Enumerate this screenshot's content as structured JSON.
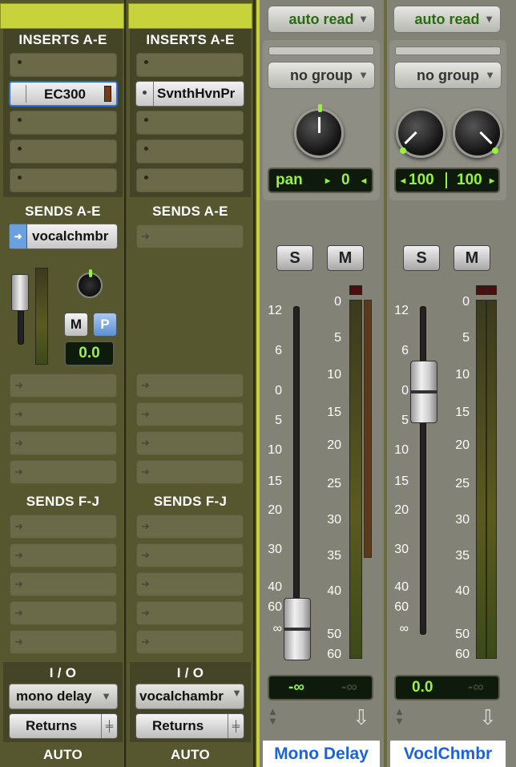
{
  "strip1": {
    "inserts_header": "INSERTS A-E",
    "insert_plugin": "EC300",
    "sends_ae_header": "SENDS A-E",
    "send_a": "vocalchmbr",
    "send_level": "0.0",
    "m_label": "M",
    "p_label": "P",
    "sends_fj_header": "SENDS F-J",
    "io_header": "I / O",
    "io_input": "mono delay",
    "io_output": "Returns",
    "auto_header": "AUTO"
  },
  "strip2": {
    "inserts_header": "INSERTS A-E",
    "insert_plugin": "SvnthHvnPr",
    "sends_ae_header": "SENDS A-E",
    "sends_fj_header": "SENDS F-J",
    "io_header": "I / O",
    "io_input": "vocalchambr",
    "io_output": "Returns",
    "auto_header": "AUTO"
  },
  "channel_mono": {
    "automation": "auto read",
    "group": "no group",
    "pan_label": "pan",
    "pan_value": "0",
    "solo": "S",
    "mute": "M",
    "fader_value": "-∞",
    "peak": "-∞",
    "name": "Mono Delay"
  },
  "channel_stereo": {
    "automation": "auto read",
    "group": "no group",
    "pan_left": "100",
    "pan_right": "100",
    "solo": "S",
    "mute": "M",
    "fader_value": "0.0",
    "peak": "-∞",
    "name": "VoclChmbr"
  },
  "fader_scale": [
    "12",
    "6",
    "0",
    "5",
    "10",
    "15",
    "20",
    "30",
    "40",
    "60",
    "∞"
  ],
  "meter_scale": [
    "0",
    "5",
    "10",
    "15",
    "20",
    "25",
    "30",
    "35",
    "40",
    "50",
    "60"
  ],
  "colors": {
    "accent": "#c8d23a",
    "lcd_text": "#9bf23a",
    "name_text": "#1a62e0"
  }
}
